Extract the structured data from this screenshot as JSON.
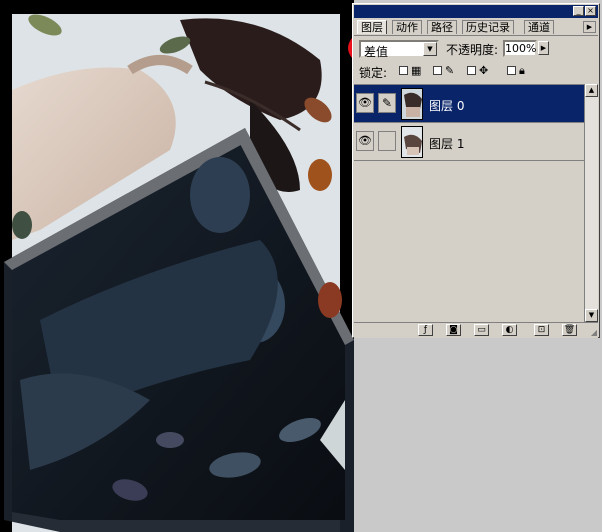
{
  "panel": {
    "tabs": [
      {
        "label": "图层",
        "active": true
      },
      {
        "label": "动作",
        "active": false
      },
      {
        "label": "路径",
        "active": false
      },
      {
        "label": "历史记录",
        "active": false
      },
      {
        "label": "通道",
        "active": false
      }
    ],
    "blend_mode": "差值",
    "opacity_label": "不透明度:",
    "opacity_value": "100%",
    "lock_label": "锁定:",
    "layers": [
      {
        "name": "图层 0",
        "visible": true,
        "selected": true
      },
      {
        "name": "图层 1",
        "visible": true,
        "selected": false
      }
    ],
    "annotation_color": "#e8101a",
    "selection_color": "#0a246a",
    "title_bar_color": "#0a246a",
    "bottom_icons": [
      "layer-style-icon",
      "mask-icon",
      "new-folder-icon",
      "adjustment-layer-icon",
      "new-layer-icon",
      "trash-icon"
    ]
  },
  "canvas": {
    "description_icons": [
      "photo-canvas"
    ]
  }
}
